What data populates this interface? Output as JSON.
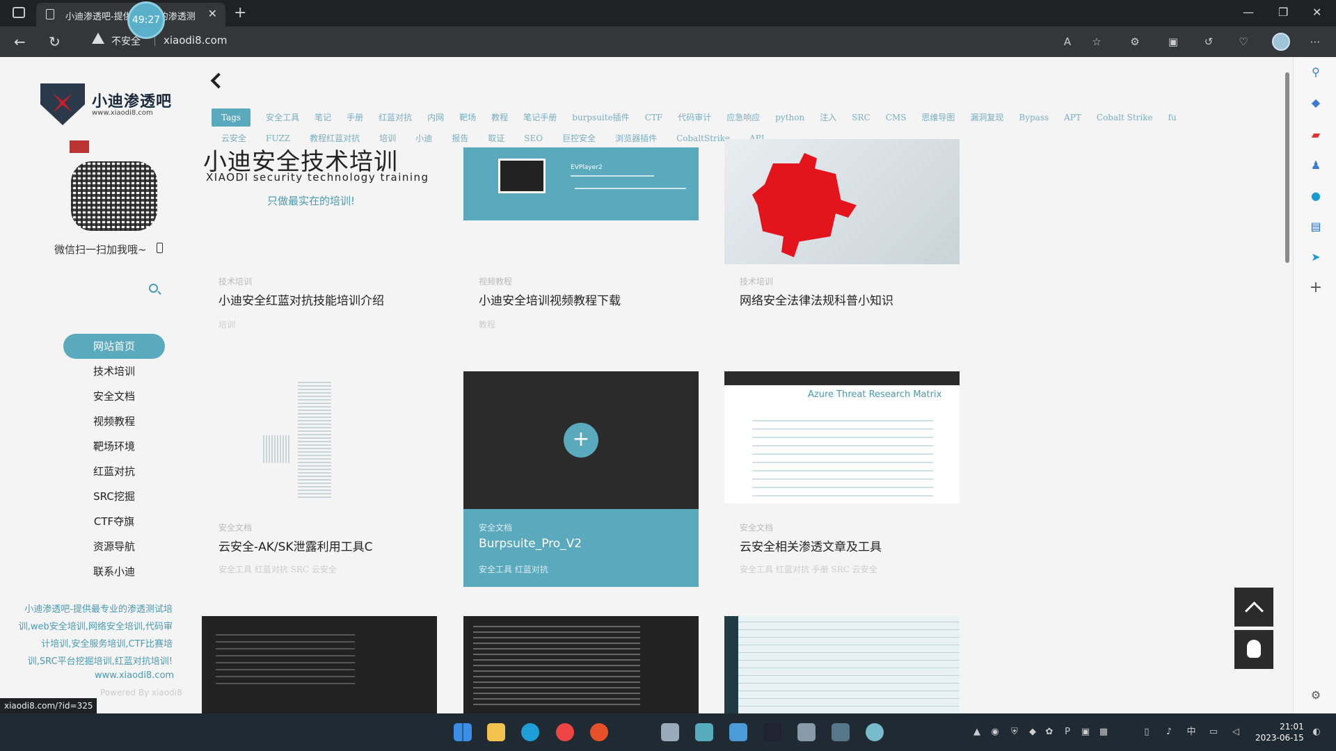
{
  "browser": {
    "tab_title": "小迪渗透吧-提供最专业的渗透测",
    "timer": "49:27",
    "insecure_label": "不安全",
    "url": "xiaodi8.com",
    "status_url": "xiaodi8.com/?id=325"
  },
  "sidebar": {
    "logo_title": "小迪渗透吧",
    "logo_sub": "www.xiaodi8.com",
    "wechat_tip": "微信扫一扫加我哦~",
    "menu": [
      {
        "label": "网站首页"
      },
      {
        "label": "技术培训"
      },
      {
        "label": "安全文档"
      },
      {
        "label": "视频教程"
      },
      {
        "label": "靶场环境"
      },
      {
        "label": "红蓝对抗"
      },
      {
        "label": "SRC挖掘"
      },
      {
        "label": "CTF夺旗"
      },
      {
        "label": "资源导航"
      },
      {
        "label": "联系小迪"
      }
    ],
    "description": "小迪渗透吧-提供最专业的渗透测试培训,web安全培训,网络安全培训,代码审计培训,安全服务培训,CTF比赛培训,SRC平台挖掘培训,红蓝对抗培训!",
    "site_url": "www.xiaodi8.com",
    "powered": "Powered By xiaodi8"
  },
  "tags_row1": [
    "Tags",
    "安全工具",
    "笔记",
    "手册",
    "红蓝对抗",
    "内网",
    "靶场",
    "教程",
    "笔记手册",
    "burpsuite插件",
    "CTF",
    "代码审计",
    "应急响应",
    "python",
    "注入",
    "SRC",
    "CMS",
    "思维导图",
    "漏洞复现",
    "Bypass",
    "APT",
    "Cobalt Strike",
    "fu"
  ],
  "tags_row2": [
    "云安全",
    "FUZZ",
    "教程红蓝对抗",
    "培训",
    "小迪",
    "报告",
    "取证",
    "SEO",
    "巨控安全",
    "浏览器插件",
    "CobaltStrike",
    "API"
  ],
  "banner": {
    "title": "小迪安全技术培训",
    "subtitle": "XIAODI security technology training",
    "slogan": "只做最实在的培训!"
  },
  "cards": [
    {
      "category": "技术培训",
      "title": "小迪安全红蓝对抗技能培训介绍",
      "tags": "培训"
    },
    {
      "category": "视频教程",
      "title": "小迪安全培训视频教程下载",
      "tags": "教程",
      "thumb_label": "EVPlayer2"
    },
    {
      "category": "技术培训",
      "title": "网络安全法律法规科普小知识",
      "tags": ""
    },
    {
      "category": "安全文档",
      "title": "云安全-AK/SK泄露利用工具C",
      "tags": "安全工具 红蓝对抗 SRC 云安全"
    },
    {
      "category": "安全文档",
      "title": "Burpsuite_Pro_V2",
      "tags": "安全工具 红蓝对抗"
    },
    {
      "category": "安全文档",
      "title": "云安全相关渗透文章及工具",
      "tags": "安全工具 红蓝对抗 手册 SRC 云安全",
      "thumb_label": "Azure Threat Research Matrix"
    }
  ],
  "taskbar": {
    "time": "21:01",
    "date": "2023-06-15",
    "ime": "中"
  },
  "colors": {
    "accent": "#5aa9bd",
    "chrome_dark": "#202124",
    "taskbar": "#1f2a33"
  }
}
